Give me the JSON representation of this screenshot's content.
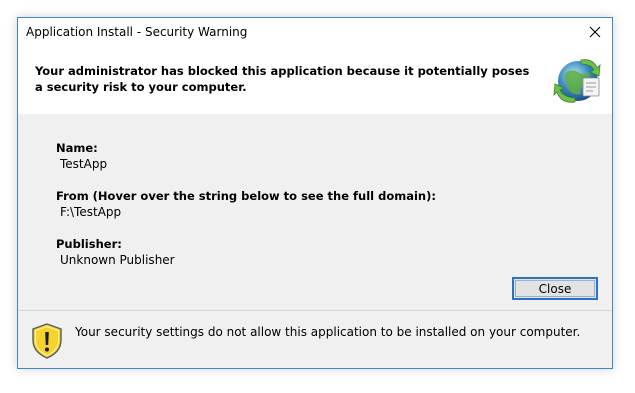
{
  "window": {
    "title": "Application Install - Security Warning"
  },
  "header": {
    "message": "Your administrator has blocked this application because it potentially poses a security risk to your computer.",
    "icon": "clickonce-globe-icon"
  },
  "details": {
    "name_label": "Name:",
    "name_value": "TestApp",
    "from_label": "From (Hover over the string below to see the full domain):",
    "from_value": "F:\\TestApp",
    "publisher_label": "Publisher:",
    "publisher_value": "Unknown Publisher"
  },
  "buttons": {
    "close_label": "Close"
  },
  "footer": {
    "message": "Your security settings do not allow this application to be installed on your computer.",
    "icon": "warning-shield-icon"
  },
  "colors": {
    "window_border": "#3f87c8",
    "button_border": "#2d73c2",
    "shield_yellow": "#f5d22c"
  }
}
